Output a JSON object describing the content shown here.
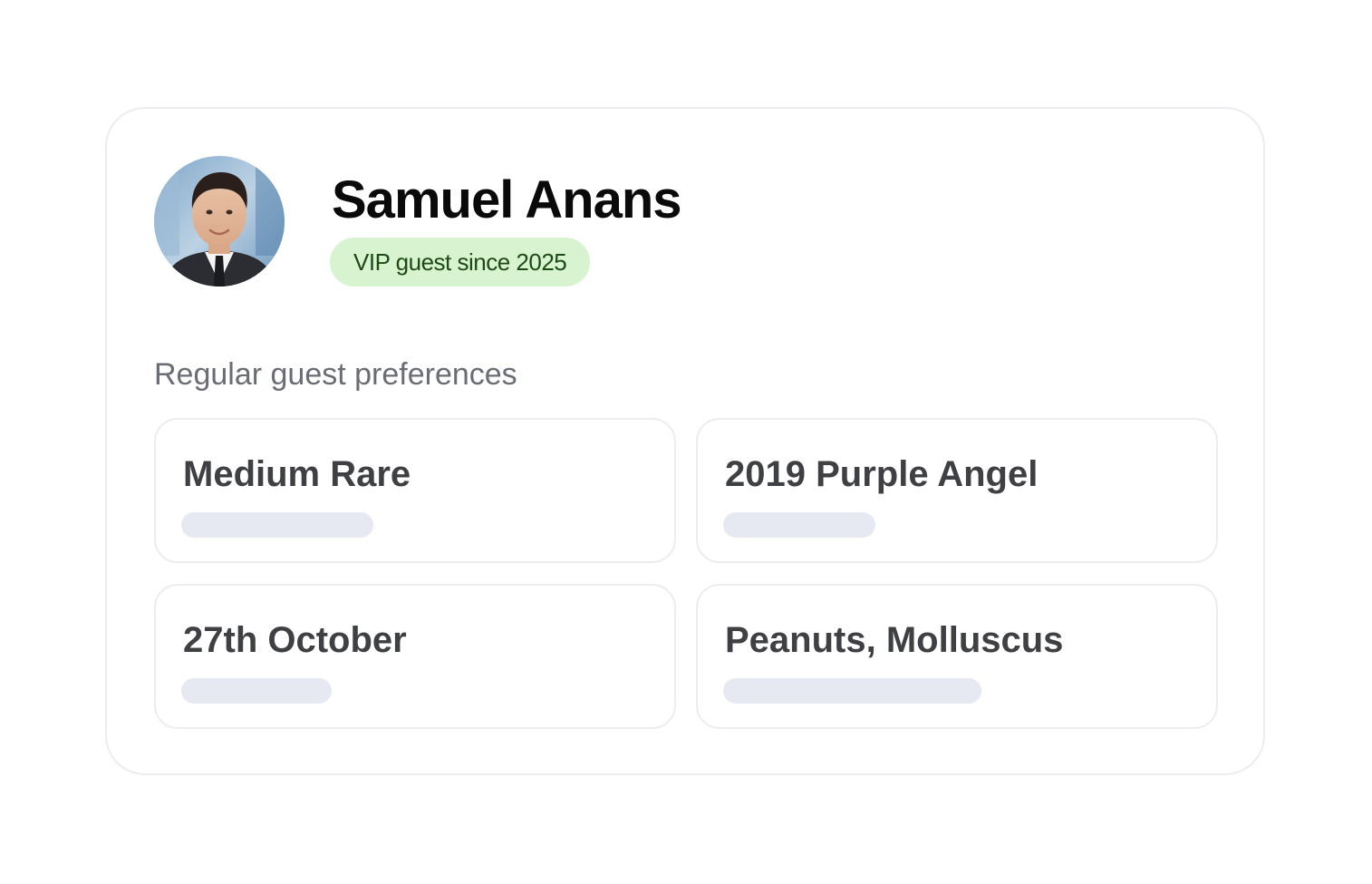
{
  "guest": {
    "name": "Samuel Anans",
    "badge": "VIP guest since 2025",
    "avatar_icon": "guest-photo-avatar"
  },
  "preferences": {
    "heading": "Regular guest preferences",
    "items": [
      {
        "label": "Medium Rare"
      },
      {
        "label": "2019 Purple Angel"
      },
      {
        "label": "27th October"
      },
      {
        "label": "Peanuts, Molluscus"
      }
    ]
  },
  "colors": {
    "badge_bg": "#d8f3d0",
    "badge_text": "#1e4a16",
    "placeholder_bar": "#e6e9f1",
    "card_border": "#ececf1"
  }
}
